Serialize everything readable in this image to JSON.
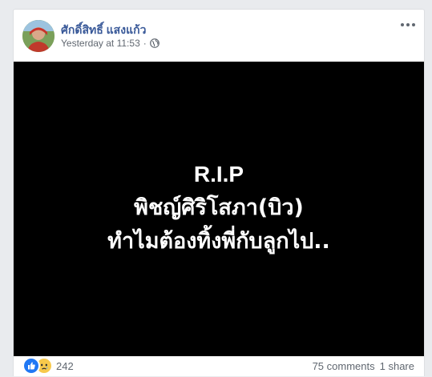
{
  "post": {
    "author": "ศักดิ์สิทธิ์ แสงแก้ว",
    "timestamp": "Yesterday at 11:53",
    "separator": "·",
    "privacy_icon": "globe-icon",
    "more_icon": "more-options-icon",
    "image_text": {
      "line1": "R.I.P",
      "line2": "พิชญ์ศิริโสภา(บิว)",
      "line3": "ทำไมต้องทิ้งพี่กับลูกไป.."
    },
    "image_background": "#000000",
    "reactions": {
      "icons": [
        "like-icon",
        "sad-icon"
      ],
      "count": "242"
    },
    "comments_label": "75 comments",
    "shares_label": "1 share"
  },
  "colors": {
    "page_background": "#e9ebee",
    "author_link": "#385898",
    "meta_text": "#606770",
    "like_blue": "#2078f4",
    "sad_yellow": "#f7c94b"
  }
}
